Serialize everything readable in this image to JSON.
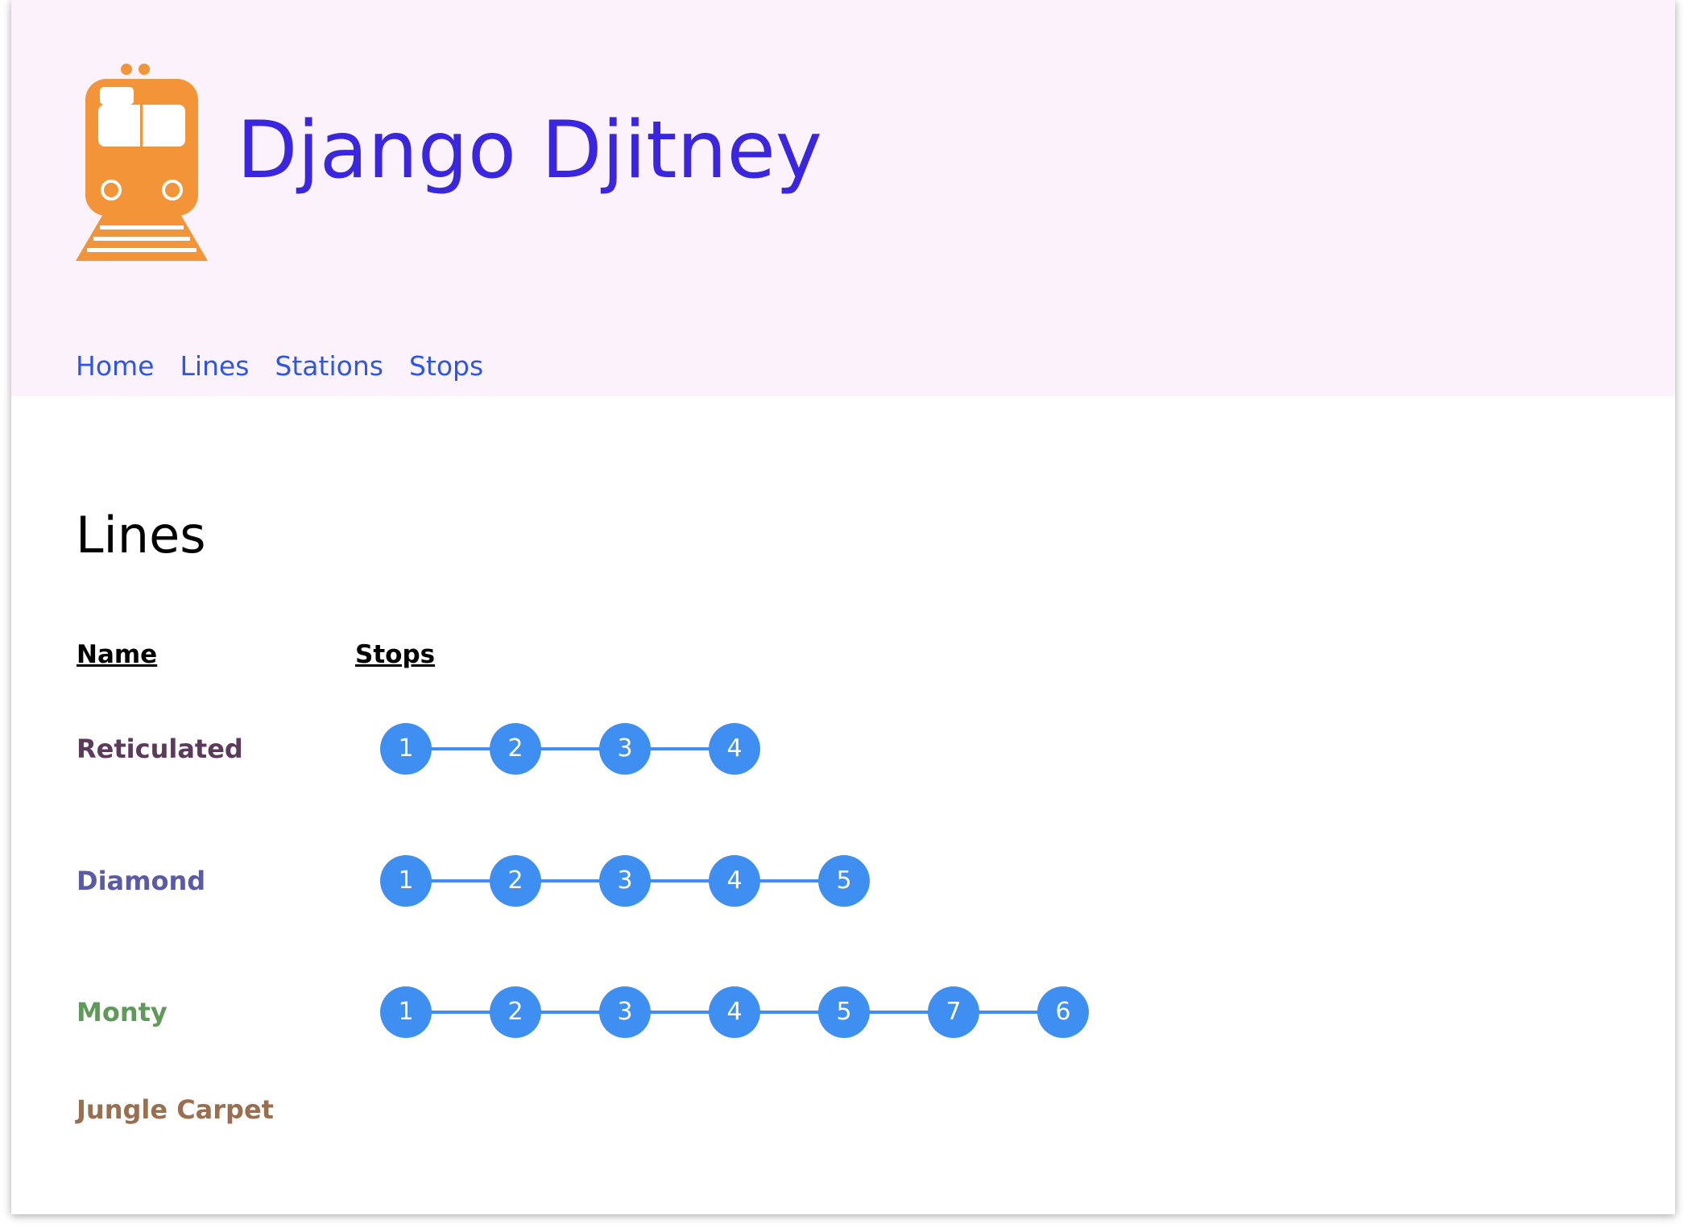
{
  "site": {
    "title": "Django Djitney",
    "logo_icon": "train-icon",
    "logo_color": "#f29437"
  },
  "nav": {
    "items": [
      {
        "label": "Home"
      },
      {
        "label": "Lines"
      },
      {
        "label": "Stations"
      },
      {
        "label": "Stops"
      }
    ]
  },
  "page": {
    "heading": "Lines",
    "columns": {
      "name": "Name",
      "stops": "Stops"
    }
  },
  "lines": [
    {
      "name": "Reticulated",
      "color": "#5c3a5c",
      "stops": [
        "1",
        "2",
        "3",
        "4"
      ]
    },
    {
      "name": "Diamond",
      "color": "#5b5aa6",
      "stops": [
        "1",
        "2",
        "3",
        "4",
        "5"
      ]
    },
    {
      "name": "Monty",
      "color": "#5f9a5a",
      "stops": [
        "1",
        "2",
        "3",
        "4",
        "5",
        "7",
        "6"
      ]
    },
    {
      "name": "Jungle Carpet",
      "color": "#9a6e4e",
      "stops": []
    }
  ],
  "colors": {
    "header_bg": "#fbf2fb",
    "title": "#3a26e0",
    "nav_link": "#2e56e6",
    "stop": "#3f8ff2"
  }
}
